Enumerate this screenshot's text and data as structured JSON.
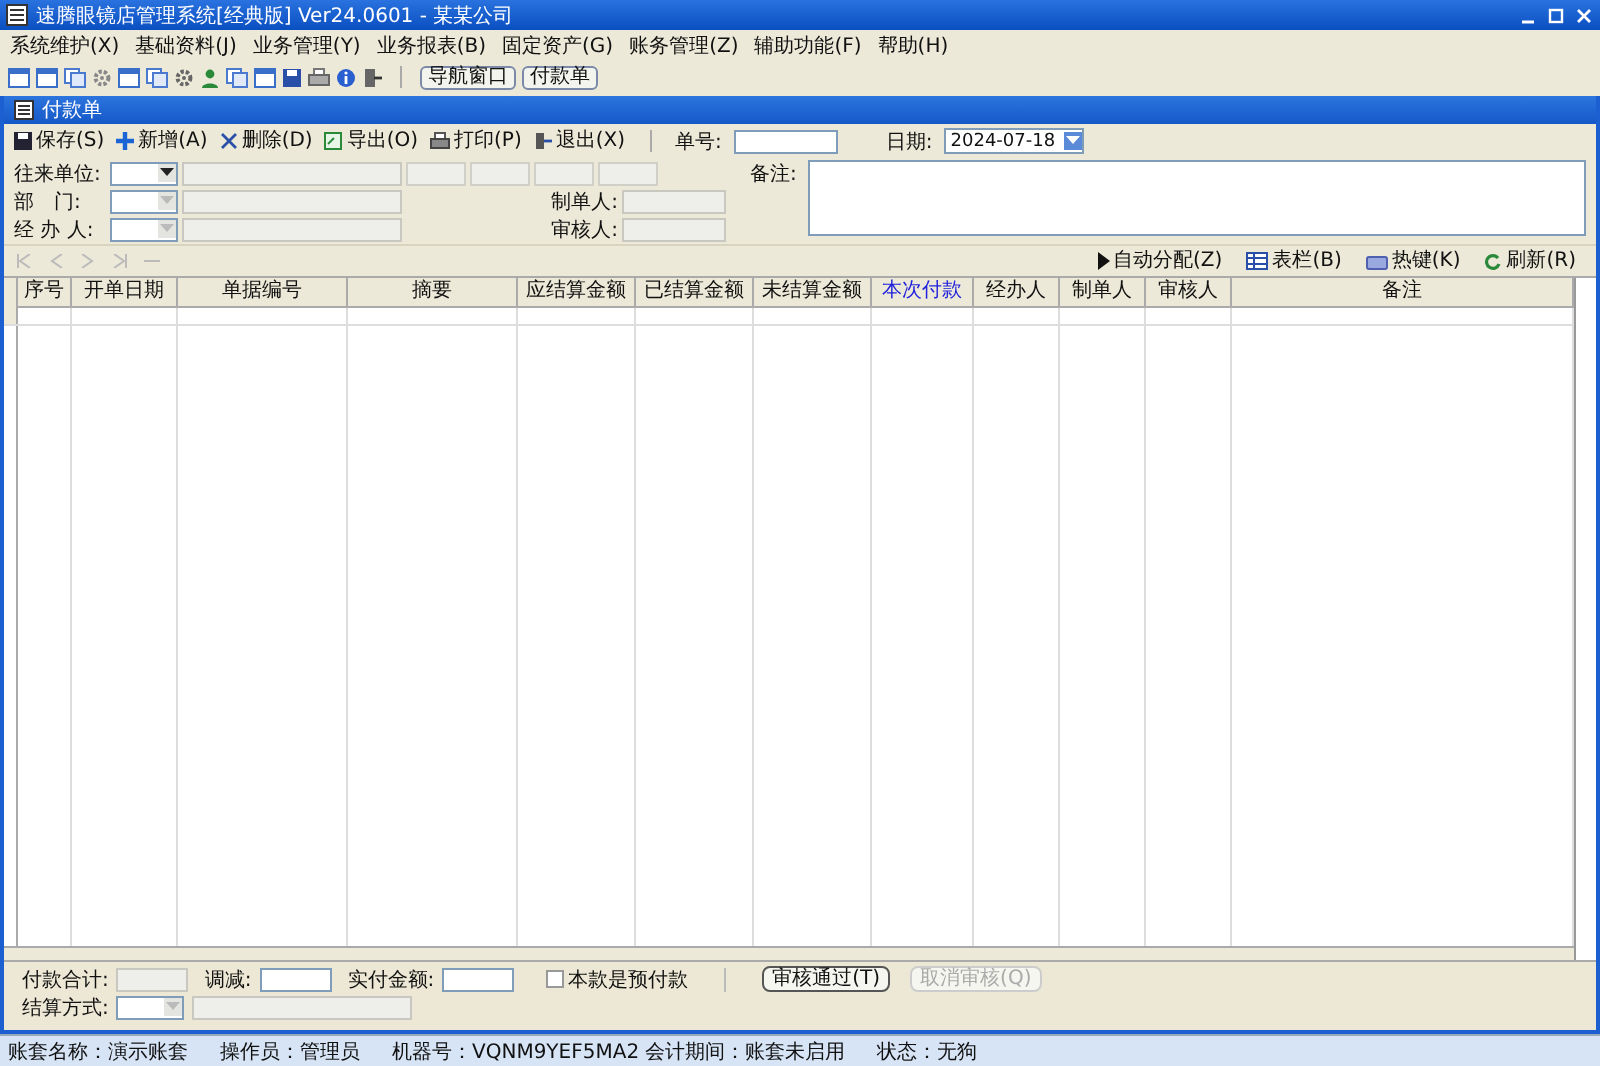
{
  "window": {
    "title": "速腾眼镜店管理系统[经典版] Ver24.0601 - 某某公司"
  },
  "menu": [
    {
      "label": "系统维护(X)"
    },
    {
      "label": "基础资料(J)"
    },
    {
      "label": "业务管理(Y)"
    },
    {
      "label": "业务报表(B)"
    },
    {
      "label": "固定资产(G)"
    },
    {
      "label": "账务管理(Z)"
    },
    {
      "label": "辅助功能(F)"
    },
    {
      "label": "帮助(H)"
    }
  ],
  "quick_buttons": [
    "导航窗口",
    "付款单"
  ],
  "document": {
    "title": "付款单"
  },
  "toolbar": [
    {
      "label": "保存(S)",
      "kind": "save"
    },
    {
      "label": "新增(A)",
      "kind": "add"
    },
    {
      "label": "删除(D)",
      "kind": "delete"
    },
    {
      "label": "导出(O)",
      "kind": "export"
    },
    {
      "label": "打印(P)",
      "kind": "print"
    },
    {
      "label": "退出(X)",
      "kind": "exit"
    }
  ],
  "number": {
    "label": "单号:"
  },
  "date": {
    "label": "日期:",
    "value": "2024-07-18"
  },
  "parties": [
    {
      "label": "往来单位:",
      "disabled": false
    },
    {
      "label": "部　门:",
      "disabled": true
    },
    {
      "label": "经 办 人:",
      "disabled": true
    }
  ],
  "makers": [
    {
      "label": "制单人:"
    },
    {
      "label": "审核人:"
    }
  ],
  "remark": {
    "label": "备注:"
  },
  "nav_actions": [
    {
      "label": "自动分配(Z)",
      "kind": "play"
    },
    {
      "label": "表栏(B)",
      "kind": "grid"
    },
    {
      "label": "热键(K)",
      "kind": "keyboard"
    },
    {
      "label": "刷新(R)",
      "kind": "refresh"
    }
  ],
  "table": {
    "columns": [
      {
        "label": "序号",
        "highlighted": false
      },
      {
        "label": "开单日期",
        "highlighted": false
      },
      {
        "label": "单据编号",
        "highlighted": false
      },
      {
        "label": "摘要",
        "highlighted": false
      },
      {
        "label": "应结算金额",
        "highlighted": false
      },
      {
        "label": "已结算金额",
        "highlighted": false
      },
      {
        "label": "未结算金额",
        "highlighted": false
      },
      {
        "label": "本次付款",
        "highlighted": true
      },
      {
        "label": "经办人",
        "highlighted": false
      },
      {
        "label": "制单人",
        "highlighted": false
      },
      {
        "label": "审核人",
        "highlighted": false
      },
      {
        "label": "备注",
        "highlighted": false
      }
    ]
  },
  "footer": {
    "totals": [
      {
        "label": "付款合计:",
        "readonly": true
      },
      {
        "label": "调减:",
        "readonly": false
      },
      {
        "label": "实付金额:",
        "readonly": false
      }
    ],
    "checkbox": {
      "label": "本款是预付款",
      "checked": false
    },
    "settlement": {
      "label": "结算方式:"
    },
    "buttons": [
      {
        "label": "审核通过(T)",
        "disabled": false
      },
      {
        "label": "取消审核(Q)",
        "disabled": true
      }
    ]
  },
  "status_bar": [
    "账套名称：演示账套",
    "操作员：管理员",
    "机器号：VQNM9YEF5MA2 会计期间：账套未启用",
    "状态：无狗"
  ]
}
